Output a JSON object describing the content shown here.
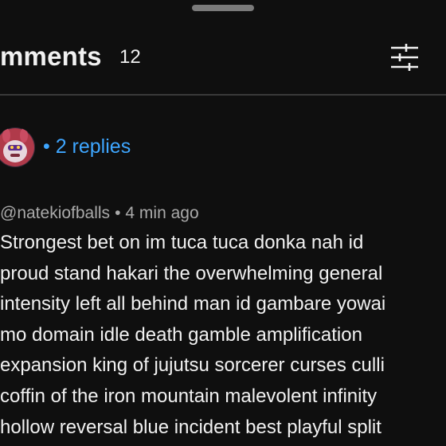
{
  "header": {
    "title": "mments",
    "count": "12"
  },
  "thread": {
    "replies_label": "• 2 replies"
  },
  "comment": {
    "author": "@natekiofballs",
    "separator": "•",
    "time": "4 min ago",
    "lines": [
      "Strongest bet on im tuca tuca donka nah id",
      "proud stand hakari the overwhelming general",
      "intensity left all behind man id gambare yowai",
      "mo domain idle death gamble amplification",
      "expansion king of jujutsu sorcerer curses culli",
      "coffin of the iron mountain malevolent infinity",
      "hollow reversal blue incident best playful split"
    ]
  },
  "colors": {
    "background": "#0f0f0f",
    "link": "#3ea6ff",
    "meta": "#aaaaaa",
    "text": "#f1f1f1"
  },
  "icons": {
    "filter": "sliders-filter-icon",
    "avatar": "user-avatar"
  }
}
